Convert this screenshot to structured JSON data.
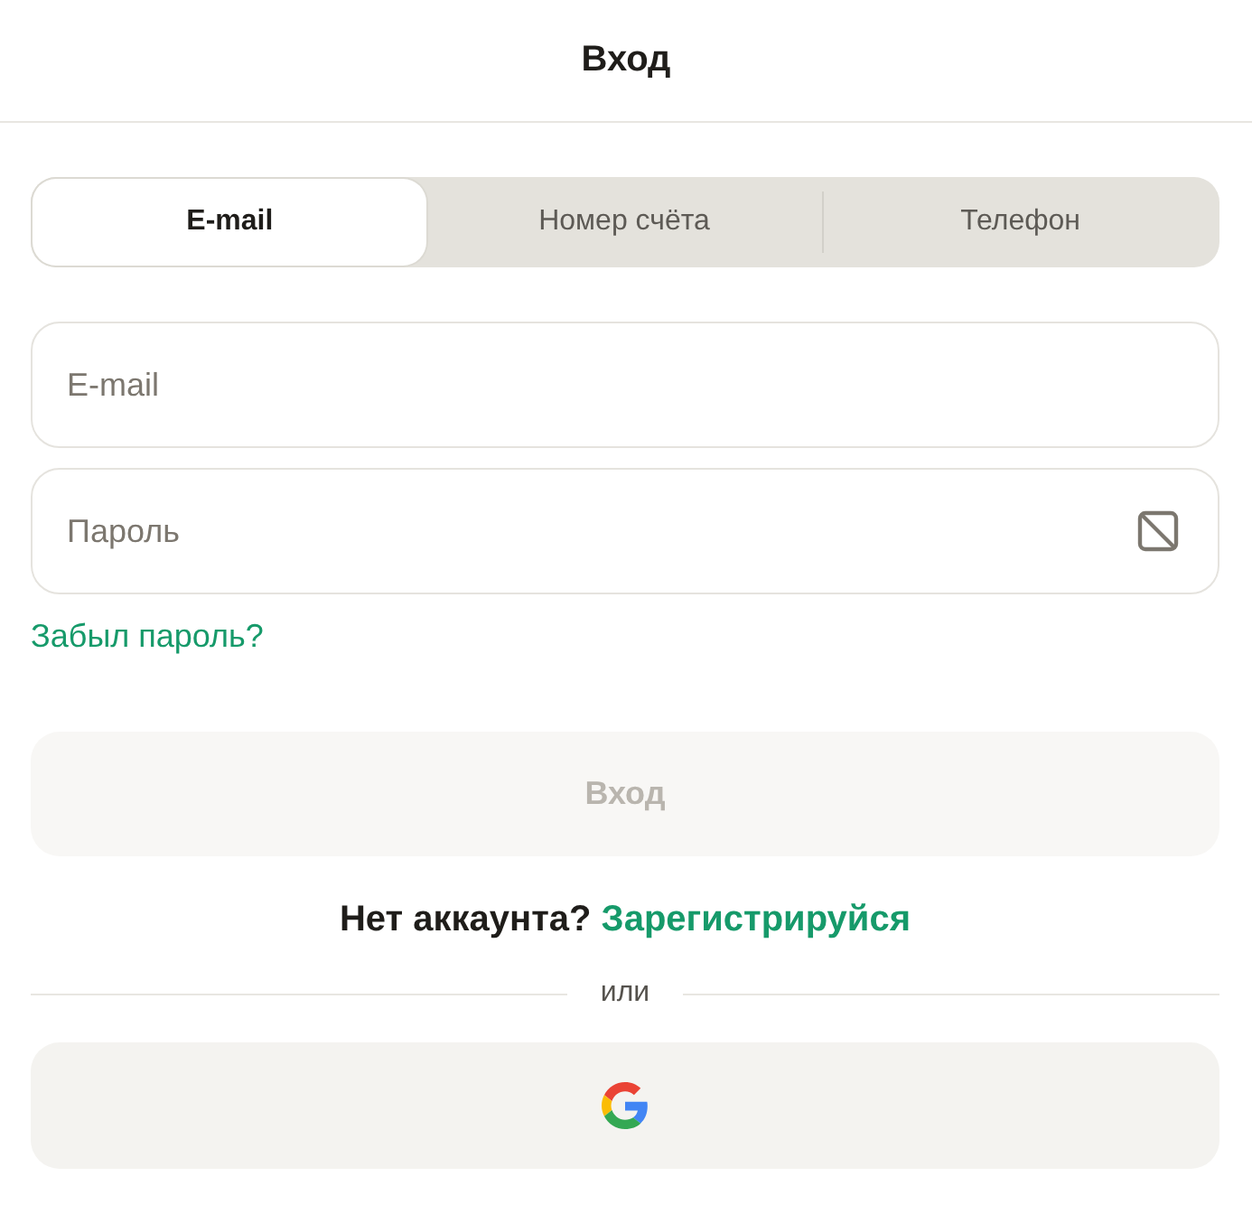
{
  "header": {
    "title": "Вход"
  },
  "tabs": [
    {
      "label": "E-mail",
      "selected": true
    },
    {
      "label": "Номер счёта",
      "selected": false
    },
    {
      "label": "Телефон",
      "selected": false
    }
  ],
  "fields": [
    {
      "kind": "text",
      "placeholder": "E-mail"
    },
    {
      "kind": "password",
      "placeholder": "Пароль"
    }
  ],
  "forgot_link": "Забыл пароль?",
  "submit": {
    "label": "Вход",
    "disabled": true
  },
  "signup": {
    "prompt": "Нет аккаунта?",
    "link": "Зарегистрируйся"
  },
  "divider": "или",
  "social": [
    {
      "kind": "google"
    }
  ]
}
